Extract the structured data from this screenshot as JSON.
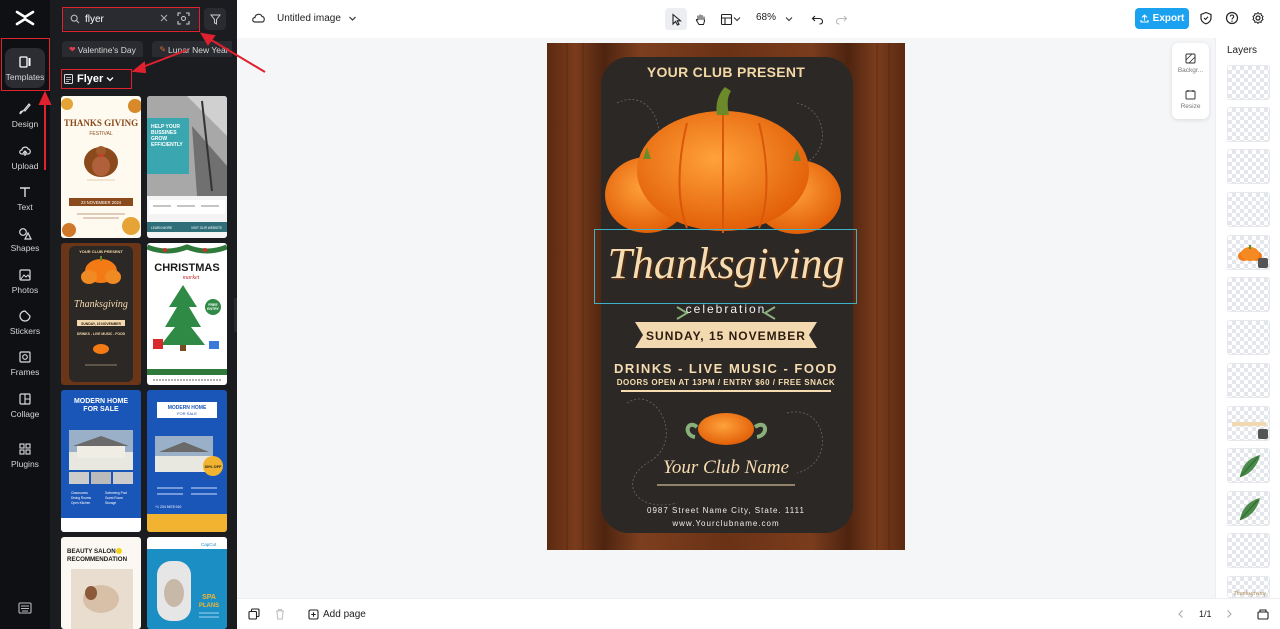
{
  "rail": {
    "items": [
      {
        "label": "Templates",
        "icon": "templates-icon"
      },
      {
        "label": "Design",
        "icon": "design-icon"
      },
      {
        "label": "Upload",
        "icon": "upload-icon"
      },
      {
        "label": "Text",
        "icon": "text-icon"
      },
      {
        "label": "Shapes",
        "icon": "shapes-icon"
      },
      {
        "label": "Photos",
        "icon": "photos-icon"
      },
      {
        "label": "Stickers",
        "icon": "stickers-icon"
      },
      {
        "label": "Frames",
        "icon": "frames-icon"
      },
      {
        "label": "Collage",
        "icon": "collage-icon"
      },
      {
        "label": "Plugins",
        "icon": "plugins-icon"
      }
    ],
    "active": "Templates"
  },
  "panel": {
    "search": {
      "value": "flyer"
    },
    "chips": [
      "Valentine's Day",
      "Lunar New Year"
    ],
    "category": "Flyer",
    "templates": [
      {
        "lines": [
          "THANKS GIVING",
          "FESTIVAL",
          "23 NOVEMBER 2024"
        ]
      },
      {
        "lines": [
          "HELP YOUR",
          "BUSSINES",
          "GROW",
          "EFFICIENTLY",
          "LEARN MORE",
          "VISIT OUR WEBSITE"
        ]
      },
      {
        "lines": [
          "YOUR CLUB PRESENT",
          "Thanksgiving",
          "SUNDAY, 15 NOVEMBER",
          "DRINKS - LIVE MUSIC - FOOD"
        ]
      },
      {
        "lines": [
          "CHRISTMAS",
          "market",
          "FREE",
          "ENTRY"
        ]
      },
      {
        "lines": [
          "MODERN HOME",
          "FOR SALE",
          "Classrooms",
          "Dining Rooms",
          "Open Kitchen",
          "Swimming Pool",
          "Guest Room",
          "Storage"
        ]
      },
      {
        "lines": [
          "MODERN HOME",
          "FOR SALE",
          "30% OFF",
          "+1 234 5678 910"
        ]
      },
      {
        "lines": [
          "BEAUTY SALON",
          "RECOMMENDATION"
        ]
      },
      {
        "lines": [
          "CapCut",
          "SPA",
          "PLANS"
        ]
      }
    ]
  },
  "topbar": {
    "title": "Untitled image",
    "zoom": "68%",
    "export_label": "Export"
  },
  "flyer": {
    "club_present": "YOUR CLUB PRESENT",
    "headline": "Thanksgiving",
    "celebration": "celebration",
    "date": "SUNDAY, 15 NOVEMBER",
    "features": "DRINKS - LIVE MUSIC - FOOD",
    "details": "DOORS OPEN AT 13PM / ENTRY $60 / FREE SNACK",
    "club_name": "Your Club Name",
    "address": "0987 Street Name City, State. 1111",
    "website": "www.Yourclubname.com"
  },
  "side_tools": [
    {
      "label": "Backgr...",
      "icon": "background-icon"
    },
    {
      "label": "Resize",
      "icon": "resize-icon"
    }
  ],
  "layers": {
    "title": "Layers",
    "count": 13,
    "last_label": "Thanksgiving"
  },
  "bottombar": {
    "add_page": "Add page",
    "pager": "1/1"
  },
  "colors": {
    "accent": "#1aa2f0",
    "annotation": "#e0212f",
    "selection": "#3fb1c7",
    "pumpkin": "#f47a16"
  }
}
